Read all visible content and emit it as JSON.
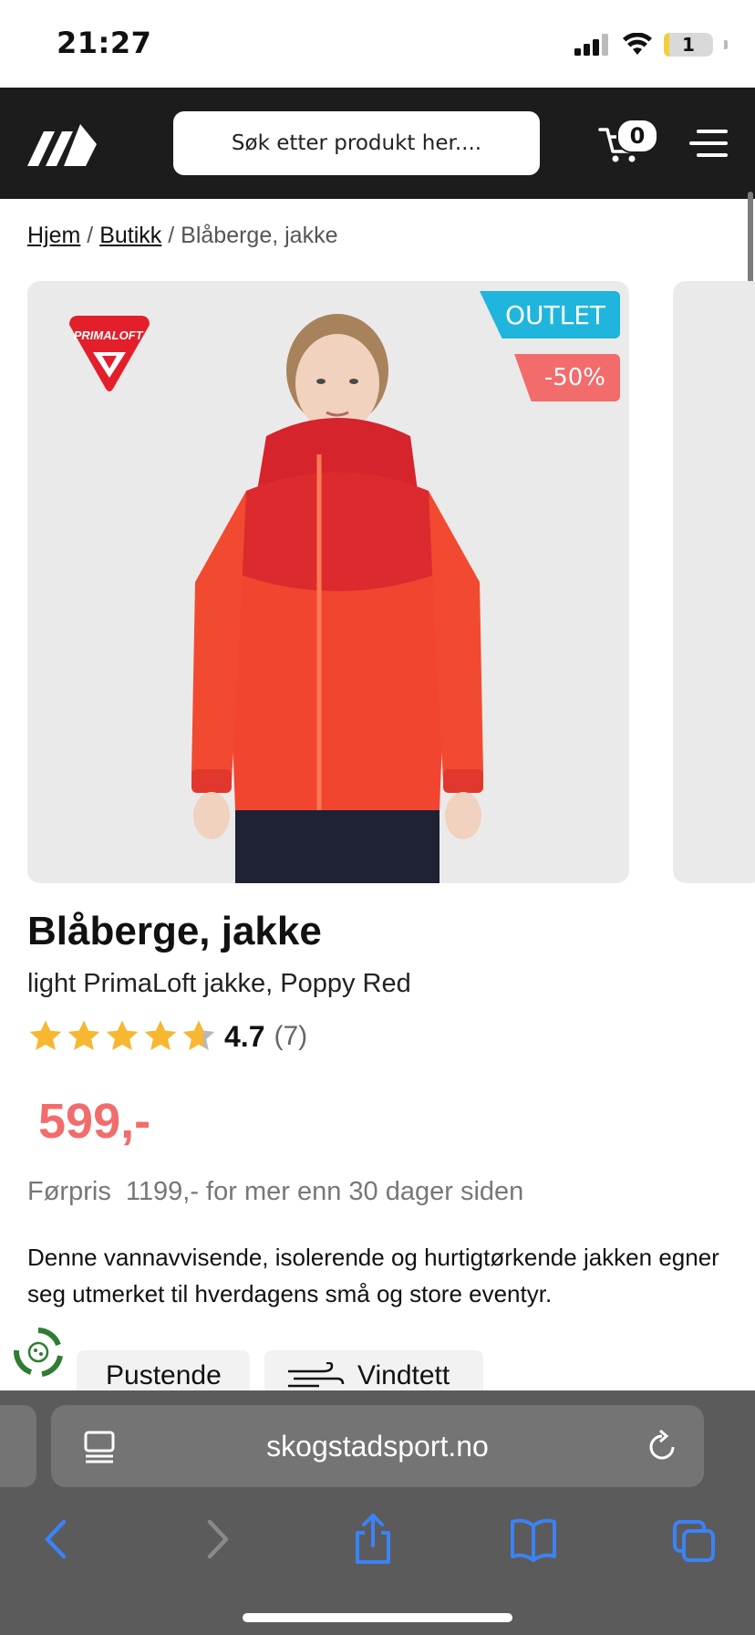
{
  "status_bar": {
    "time": "21:27",
    "battery_level": "1"
  },
  "header": {
    "search_placeholder": "Søk etter produkt her....",
    "cart_count": "0"
  },
  "breadcrumb": {
    "home": "Hjem",
    "separator": "/",
    "shop": "Butikk",
    "current": "Blåberge, jakke"
  },
  "product": {
    "badge_outlet": "OUTLET",
    "badge_discount": "-50%",
    "brand_badge": "PRIMALOFT.",
    "title": "Blåberge, jakke",
    "subtitle": "light PrimaLoft jakke, Poppy Red",
    "rating": 4.7,
    "rating_text": "4.7",
    "rating_count": "(7)",
    "price": "599,-",
    "previous_price": "Førpris  1199,- for mer enn 30 dager siden",
    "description": "Denne vannavvisende, isolerende og hurtigtørkende jakken egner seg utmerket til hverdagens små og store eventyr."
  },
  "features": [
    {
      "label": "Pustende"
    },
    {
      "label": "Vindtett"
    }
  ],
  "browser": {
    "url": "skogstadsport.no"
  },
  "colors": {
    "header_bg": "#1c1c1c",
    "outlet_badge": "#1fb5dc",
    "discount_badge": "#f26c6c",
    "price": "#f26c6c",
    "star": "#f7b731",
    "jacket": "#f2452f"
  }
}
